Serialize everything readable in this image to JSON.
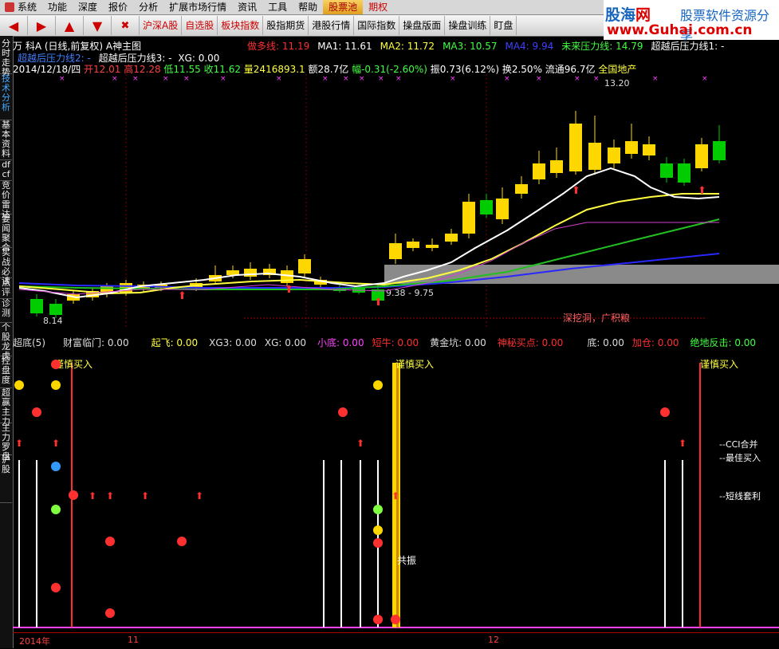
{
  "menubar": {
    "items": [
      "系统",
      "功能",
      "深度",
      "报价",
      "分析",
      "扩展市场行情",
      "资讯",
      "工具",
      "帮助",
      "股票池",
      "期权"
    ],
    "highlight_index": 9
  },
  "toolbar": {
    "buttons": [
      "沪深A股",
      "自选股",
      "板块指数",
      "股指期货",
      "港股行情",
      "国际指数",
      "操盘版面",
      "操盘训练",
      "盯盘"
    ]
  },
  "logo": {
    "line1_a": "股海",
    "line1_b": "网",
    "line1_c": "股票软件资源分享",
    "line2": "www.Guhai.com.cn"
  },
  "sidebar": {
    "tabs": [
      {
        "label": "分时走势",
        "active": false
      },
      {
        "label": "技术分析",
        "active": true
      },
      {
        "label": "基本资料",
        "active": false
      },
      {
        "label": "dfcf",
        "active": false
      },
      {
        "label": "竞价雷达",
        "active": false
      },
      {
        "label": "要闻聚合",
        "active": false
      },
      {
        "label": "实战必读",
        "active": false
      },
      {
        "label": "点评",
        "active": false
      },
      {
        "label": "诊测",
        "active": false
      },
      {
        "label": "个股龙虎",
        "active": false
      },
      {
        "label": "控盘度",
        "active": false
      },
      {
        "label": "超赢主力",
        "active": false
      },
      {
        "label": "主力罗盘",
        "active": false
      },
      {
        "label": "沪股",
        "active": false
      }
    ]
  },
  "main_chart": {
    "title_prefix": "万 科A",
    "title_mode": "(日线,前复权)",
    "title_indicator": "A神主图",
    "indicators": [
      {
        "label": "做多线: 11.19",
        "color": "#ff3030"
      },
      {
        "label": "MA1: 11.61",
        "color": "#ffffff"
      },
      {
        "label": "MA2: 11.72",
        "color": "#ffff40"
      },
      {
        "label": "MA3: 10.57",
        "color": "#40ff40"
      },
      {
        "label": "MA4: 9.94",
        "color": "#4040ff"
      },
      {
        "label": "未来压力线: 14.79",
        "color": "#40ff40"
      },
      {
        "label": "超越后压力线1: -",
        "color": "#ffffff"
      }
    ],
    "line2_a": "超越后压力线2: -",
    "line2_b": "超越后压力线3: -",
    "line2_c": "XG: 0.00",
    "quote": {
      "date": "2014/12/18/四",
      "open": "开12.01",
      "high": "高12.28",
      "low": "低11.55",
      "close": "收11.62",
      "vol": "量2416893.1",
      "amount": "额28.7亿",
      "change": "幅-0.31(-2.60%)",
      "amplitude": "振0.73(6.12%)",
      "turnover": "换2.50%",
      "float": "流通96.7亿",
      "sector": "全国地产"
    },
    "price_high_label": "13.20",
    "price_low_label": "8.14",
    "zone_label": "9.38 - 9.75",
    "slogan": "深挖洞，广积粮"
  },
  "sub_chart": {
    "indicators": [
      {
        "label": "超底(5)",
        "color": "#dddddd"
      },
      {
        "label": "财富临门: 0.00",
        "color": "#dddddd"
      },
      {
        "label": "起飞: 0.00",
        "color": "#ffff40"
      },
      {
        "label": "XG3: 0.00",
        "color": "#dddddd"
      },
      {
        "label": "XG: 0.00",
        "color": "#dddddd"
      },
      {
        "label": "小底: 0.00",
        "color": "#ff40ff"
      },
      {
        "label": "短牛: 0.00",
        "color": "#ff3030"
      },
      {
        "label": "黄金坑: 0.00",
        "color": "#dddddd"
      },
      {
        "label": "神秘买点: 0.00",
        "color": "#ff3030"
      },
      {
        "label": "底: 0.00",
        "color": "#dddddd"
      },
      {
        "label": "加仓: 0.00",
        "color": "#ff3030"
      },
      {
        "label": "绝地反击: 0.00",
        "color": "#40ff40"
      }
    ],
    "signal_label": "谨慎买入",
    "right_labels": [
      "--CCI合并",
      "--最佳买入",
      "--短线套利"
    ],
    "mid_label": "共振"
  },
  "time_axis": [
    "2014年",
    "11",
    "12"
  ],
  "colors": {
    "up": "#ffd700",
    "down": "#00cc00",
    "bg": "#000000"
  }
}
